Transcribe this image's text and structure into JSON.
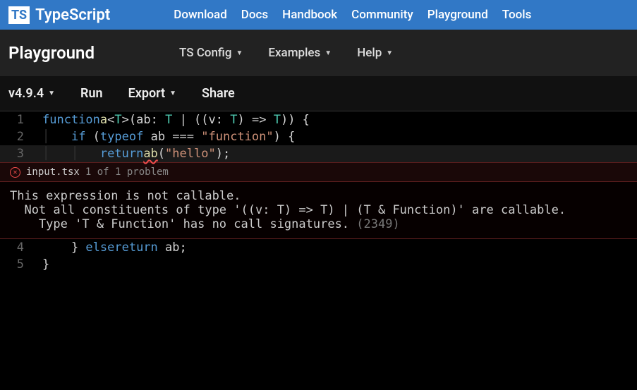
{
  "brand": {
    "logo": "TS",
    "name": "TypeScript"
  },
  "nav": [
    "Download",
    "Docs",
    "Handbook",
    "Community",
    "Playground",
    "Tools"
  ],
  "subnav": {
    "title": "Playground",
    "items": [
      "TS Config",
      "Examples",
      "Help"
    ]
  },
  "toolbar": {
    "version": "v4.9.4",
    "run": "Run",
    "export": "Export",
    "share": "Share"
  },
  "code": {
    "lines": [
      {
        "n": "1",
        "tokens": [
          [
            "kw",
            "function"
          ],
          [
            "id",
            " "
          ],
          [
            "fn",
            "a"
          ],
          [
            "op",
            "<"
          ],
          [
            "type",
            "T"
          ],
          [
            "op",
            ">("
          ],
          [
            "id",
            "ab"
          ],
          [
            "op",
            ": "
          ],
          [
            "type",
            "T"
          ],
          [
            "op",
            " | (("
          ],
          [
            "id",
            "v"
          ],
          [
            "op",
            ": "
          ],
          [
            "type",
            "T"
          ],
          [
            "op",
            ") => "
          ],
          [
            "type",
            "T"
          ],
          [
            "op",
            ")) {"
          ]
        ]
      },
      {
        "n": "2",
        "tokens": [
          [
            "id",
            "    "
          ],
          [
            "kw",
            "if"
          ],
          [
            "op",
            " ("
          ],
          [
            "kw",
            "typeof"
          ],
          [
            "id",
            " ab "
          ],
          [
            "op",
            "=== "
          ],
          [
            "str",
            "\"function\""
          ],
          [
            "op",
            ") {"
          ]
        ]
      },
      {
        "n": "3",
        "hl": true,
        "tokens": [
          [
            "id",
            "        "
          ],
          [
            "kw",
            "return"
          ],
          [
            "id",
            " "
          ],
          [
            "sq",
            "ab"
          ],
          [
            "op",
            "("
          ],
          [
            "str",
            "\"hello\""
          ],
          [
            "op",
            ");"
          ]
        ]
      },
      {
        "n": "4",
        "tokens": [
          [
            "id",
            "    } "
          ],
          [
            "kw",
            "else"
          ],
          [
            "id",
            " "
          ],
          [
            "kw",
            "return"
          ],
          [
            "id",
            " ab;"
          ]
        ]
      },
      {
        "n": "5",
        "tokens": [
          [
            "op",
            "}"
          ]
        ]
      }
    ]
  },
  "error": {
    "file": "input.tsx",
    "count": "1 of 1 problem",
    "lines": [
      "This expression is not callable.",
      "  Not all constituents of type '((v: T) => T) | (T & Function)' are callable.",
      "    Type 'T & Function' has no call signatures."
    ],
    "code": "(2349)"
  }
}
